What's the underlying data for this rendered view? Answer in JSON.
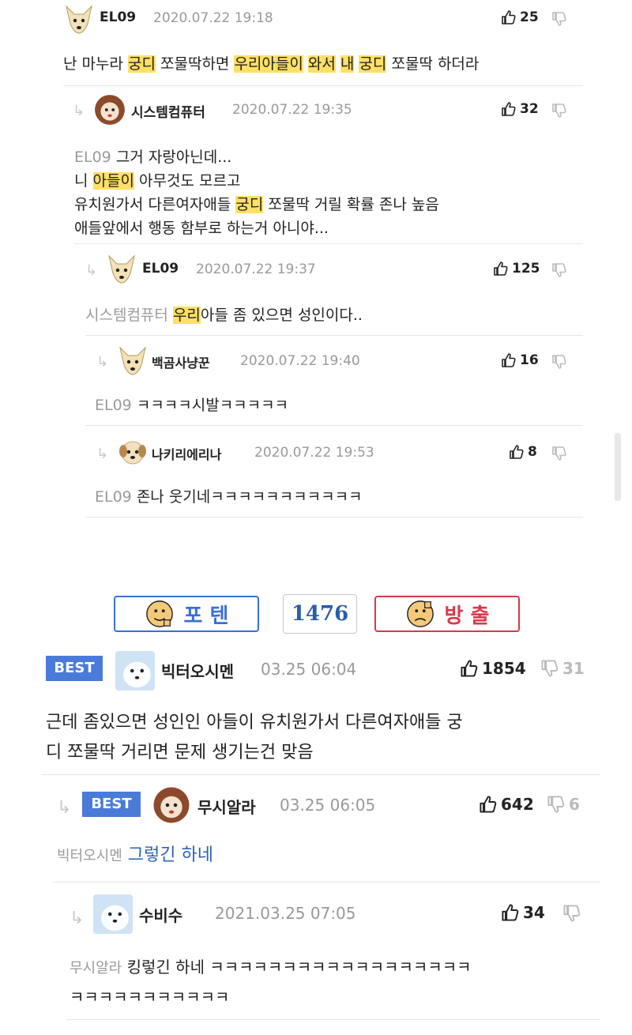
{
  "thread1": {
    "c1": {
      "name": "EL09",
      "date": "2020.07.22 19:18",
      "up": "25"
    },
    "c1_text": {
      "a": "난 마누라 ",
      "b": "궁디",
      "c": " 쪼물딱하면 ",
      "d": "우리아들이",
      "e": " ",
      "f": "와서",
      "g": " ",
      "h": "내",
      "i": " ",
      "j": "궁디",
      "k": " 쪼물딱 하더라"
    },
    "c2": {
      "name": "시스템컴퓨터",
      "date": "2020.07.22 19:35",
      "up": "32"
    },
    "c2_text": {
      "ref": "EL09",
      "l1": " 그거 자랑아닌데...",
      "l2a": "니 ",
      "l2b": "아들이",
      "l2c": " 아무것도 모르고",
      "l3a": "유치원가서 다른여자애들 ",
      "l3b": "궁디",
      "l3c": " 쪼물딱 거릴 확률 존나 높음",
      "l4": "애들앞에서 행동 함부로 하는거 아니야..."
    },
    "c3": {
      "name": "EL09",
      "date": "2020.07.22 19:37",
      "up": "125"
    },
    "c3_text": {
      "ref": "시스템컴퓨터",
      "a": " ",
      "b": "우리",
      "c": "아들 좀 있으면 성인이다.."
    },
    "c4": {
      "name": "백곰사냥꾼",
      "date": "2020.07.22 19:40",
      "up": "16"
    },
    "c4_text": {
      "ref": "EL09",
      "a": " ㅋㅋㅋㅋ시발ㅋㅋㅋㅋㅋ"
    },
    "c5": {
      "name": "나키리에리나",
      "date": "2020.07.22 19:53",
      "up": "8"
    },
    "c5_text": {
      "ref": "EL09",
      "a": " 존나 웃기네ㅋㅋㅋㅋㅋㅋㅋㅋㅋㅋㅋ"
    }
  },
  "votes": {
    "poten": "포 텐",
    "count": "1476",
    "bangchul": "방 출"
  },
  "thread2": {
    "best_label": "BEST",
    "b1": {
      "name": "빅터오시멘",
      "date": "03.25 06:04",
      "up": "1854",
      "down": "31"
    },
    "b1_text": {
      "l1": "근데 좀있으면 성인인 아들이 유치원가서 다른여자애들 궁",
      "l2": "디 쪼물딱 거리면 문제 생기는건 맞음"
    },
    "b2": {
      "name": "무시알라",
      "date": "03.25 06:05",
      "up": "642",
      "down": "6"
    },
    "b2_text": {
      "ref": "빅터오시멘",
      "a": " 그렇긴 하네"
    },
    "b3": {
      "name": "수비수",
      "date": "2021.03.25 07:05",
      "up": "34"
    },
    "b3_text": {
      "ref": "무시알라",
      "a": " 킹렇긴 하네 ㅋㅋㅋㅋㅋㅋㅋㅋㅋㅋㅋㅋㅋㅋㅋㅋㅋㅋ",
      "l2": "ㅋㅋㅋㅋㅋㅋㅋㅋㅋㅋㅋ"
    }
  },
  "colors": {
    "highlight": "#ffe066",
    "best": "#4a7bd8",
    "poten": "#3a6fd8",
    "bangchul": "#d83a4a",
    "count": "#2a5fa8"
  }
}
